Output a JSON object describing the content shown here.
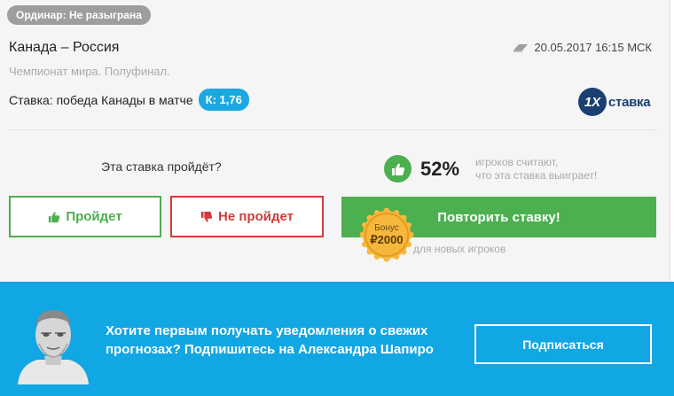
{
  "card": {
    "badge": "Ординар: Не разыграна",
    "match_title": "Канада – Россия",
    "date": "20.05.2017 16:15 МСК",
    "tournament": "Чемпионат мира. Полуфинал.",
    "bet_text": "Ставка: победа Канады в матче",
    "coef": "К: 1,76",
    "bookmaker_logo_num": "1X",
    "bookmaker_logo_text": "ставка"
  },
  "vote": {
    "question": "Эта ставка пройдёт?",
    "percent": "52%",
    "stat_line1": "игроков считают,",
    "stat_line2": "что эта ставка выиграет!",
    "yes_label": "Пройдет",
    "no_label": "Не пройдет"
  },
  "repeat": {
    "button_label": "Повторить ставку!",
    "bonus_label": "Бонус",
    "bonus_amount": "₽2000",
    "note": "для новых игроков"
  },
  "subscribe": {
    "text": "Хотите первым получать уведомления о свежих прогнозах? Подпишитесь на Александра Шапиро",
    "button_label": "Подписаться"
  },
  "colors": {
    "green": "#4caf50",
    "red": "#d03c3c",
    "blue": "#11a6e4",
    "coef_blue": "#1ba8e0",
    "gold": "#f5b83d"
  },
  "icons": [
    "clock-icon",
    "thumb-up-icon",
    "thumb-down-icon",
    "bonus-badge-icon"
  ]
}
